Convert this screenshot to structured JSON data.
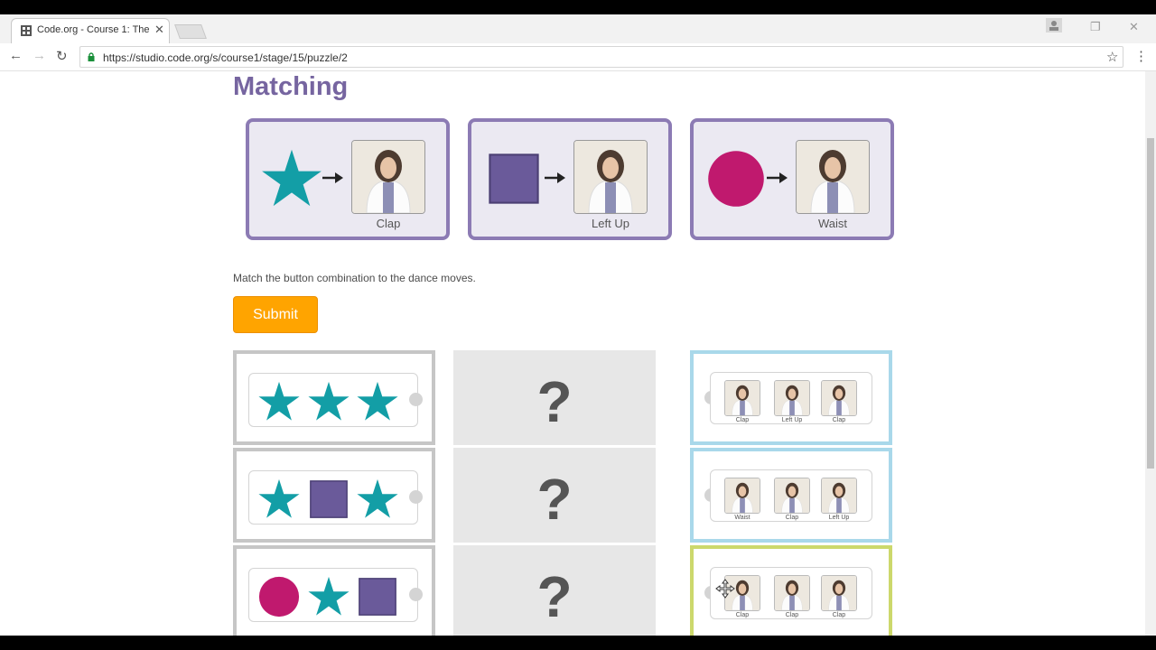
{
  "browser": {
    "tab_title": "Code.org - Course 1: The",
    "url": "https://studio.code.org/s/course1/stage/15/puzzle/2"
  },
  "page": {
    "title": "Matching",
    "instruction": "Match the button combination to the dance moves.",
    "submit_label": "Submit"
  },
  "examples": [
    {
      "shape": "star",
      "label": "Clap"
    },
    {
      "shape": "square",
      "label": "Left Up"
    },
    {
      "shape": "circle",
      "label": "Waist"
    }
  ],
  "sequences": [
    {
      "shapes": [
        "star",
        "star",
        "star"
      ]
    },
    {
      "shapes": [
        "star",
        "square",
        "star"
      ]
    },
    {
      "shapes": [
        "circle",
        "star",
        "square"
      ]
    }
  ],
  "answer_placeholder": "?",
  "dance_moves": [
    {
      "labels": [
        "Clap",
        "Left Up",
        "Clap"
      ]
    },
    {
      "labels": [
        "Waist",
        "Clap",
        "Left Up"
      ]
    },
    {
      "labels": [
        "Clap",
        "Clap",
        "Clap"
      ]
    }
  ],
  "colors": {
    "title": "#7665a0",
    "star": "#139ea6",
    "square": "#6a5a9a",
    "circle": "#c0196e",
    "submit": "#ffa400",
    "card_border": "#8c7bb4",
    "card_bg": "#ebe9f2",
    "left_border": "#c6c6c6",
    "right_border": "#a9d8ea",
    "selected_border": "#ccd86c"
  },
  "icons": {
    "star": "star-icon",
    "square": "square-icon",
    "circle": "circle-icon",
    "arrow": "arrow-right-icon",
    "dancer": "dancer-photo"
  }
}
